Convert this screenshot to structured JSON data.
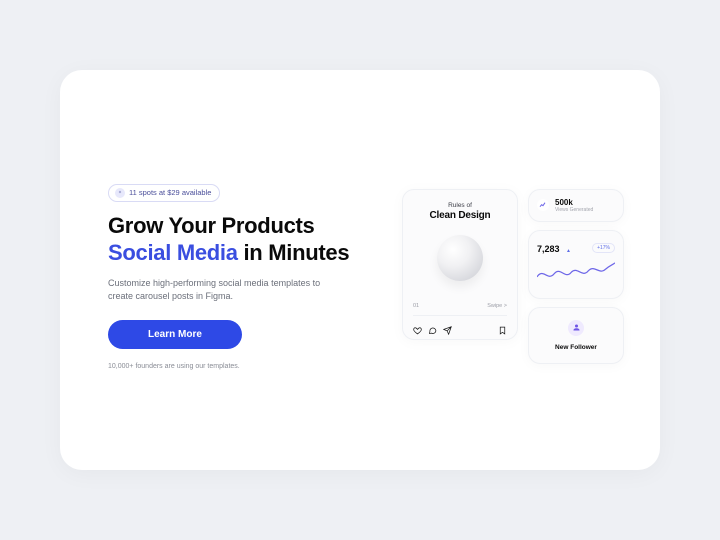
{
  "badge": {
    "icon_label": "spark",
    "text": "11 spots at $29 available"
  },
  "headline": {
    "line1": "Grow Your Products",
    "accent": "Social Media",
    "line2_tail": " in Minutes"
  },
  "subheading": "Customize high-performing social media templates to create carousel posts in Figma.",
  "cta_label": "Learn More",
  "microcopy": "10,000+ founders are using our templates.",
  "post_card": {
    "kicker": "Rules of",
    "title": "Clean Design",
    "page_number": "01",
    "swipe_hint": "Swipe >"
  },
  "stats": {
    "views": {
      "value": "500k",
      "label": "Views Generated"
    },
    "metric": {
      "value": "7,283",
      "delta": "+17%"
    },
    "follower": {
      "label": "New Follower"
    }
  },
  "colors": {
    "accent": "#3a4ee0",
    "cta": "#2e49e6",
    "spark": "#6e67e8"
  }
}
